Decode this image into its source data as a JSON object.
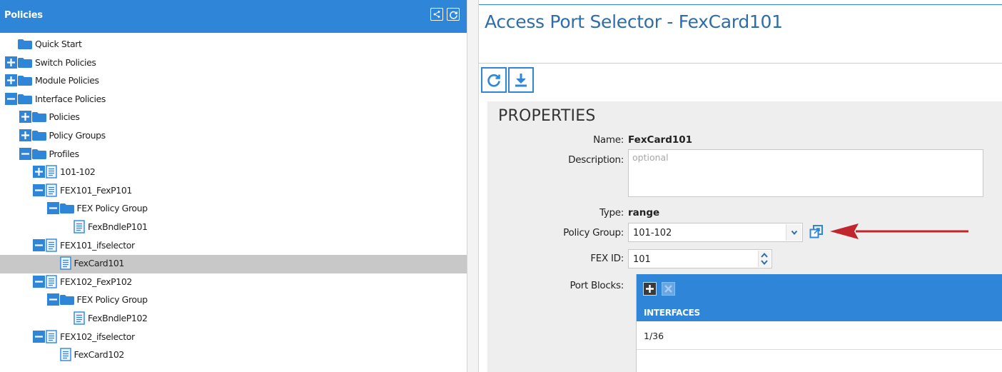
{
  "left_panel": {
    "title": "Policies",
    "tree": [
      {
        "label": "Quick Start",
        "depth": 0,
        "toggle": "none",
        "icon": "folder-icon"
      },
      {
        "label": "Switch Policies",
        "depth": 0,
        "toggle": "plus",
        "icon": "folder-icon"
      },
      {
        "label": "Module Policies",
        "depth": 0,
        "toggle": "plus",
        "icon": "folder-icon"
      },
      {
        "label": "Interface Policies",
        "depth": 0,
        "toggle": "minus",
        "icon": "folder-icon"
      },
      {
        "label": "Policies",
        "depth": 1,
        "toggle": "plus",
        "icon": "folder-icon"
      },
      {
        "label": "Policy Groups",
        "depth": 1,
        "toggle": "plus",
        "icon": "folder-icon"
      },
      {
        "label": "Profiles",
        "depth": 1,
        "toggle": "minus",
        "icon": "folder-icon"
      },
      {
        "label": "101-102",
        "depth": 2,
        "toggle": "plus",
        "icon": "document-icon"
      },
      {
        "label": "FEX101_FexP101",
        "depth": 2,
        "toggle": "minus",
        "icon": "document-icon"
      },
      {
        "label": "FEX Policy Group",
        "depth": 3,
        "toggle": "minus",
        "icon": "folder-icon"
      },
      {
        "label": "FexBndleP101",
        "depth": 4,
        "toggle": "none",
        "icon": "document-icon"
      },
      {
        "label": "FEX101_ifselector",
        "depth": 2,
        "toggle": "minus",
        "icon": "document-icon"
      },
      {
        "label": "FexCard101",
        "depth": 3,
        "toggle": "none",
        "icon": "document-icon",
        "selected": true
      },
      {
        "label": "FEX102_FexP102",
        "depth": 2,
        "toggle": "minus",
        "icon": "document-icon"
      },
      {
        "label": "FEX Policy Group",
        "depth": 3,
        "toggle": "minus",
        "icon": "folder-icon"
      },
      {
        "label": "FexBndleP102",
        "depth": 4,
        "toggle": "none",
        "icon": "document-icon"
      },
      {
        "label": "FEX102_ifselector",
        "depth": 2,
        "toggle": "minus",
        "icon": "document-icon"
      },
      {
        "label": "FexCard102",
        "depth": 3,
        "toggle": "none",
        "icon": "document-icon"
      }
    ]
  },
  "main": {
    "title": "Access Port Selector - FexCard101",
    "properties_title": "PROPERTIES",
    "name_label": "Name:",
    "name_value": "FexCard101",
    "description_label": "Description:",
    "description_placeholder": "optional",
    "type_label": "Type:",
    "type_value": "range",
    "policy_group_label": "Policy Group:",
    "policy_group_value": "101-102",
    "fex_id_label": "FEX ID:",
    "fex_id_value": "101",
    "port_blocks_label": "Port Blocks:",
    "interfaces_header": "INTERFACES",
    "interfaces_rows": [
      "1/36"
    ]
  },
  "colors": {
    "accent": "#2f86d9",
    "title_blue": "#2f6da8",
    "selected_row": "#c8c8c8",
    "annotation_arrow": "#c0262b"
  }
}
